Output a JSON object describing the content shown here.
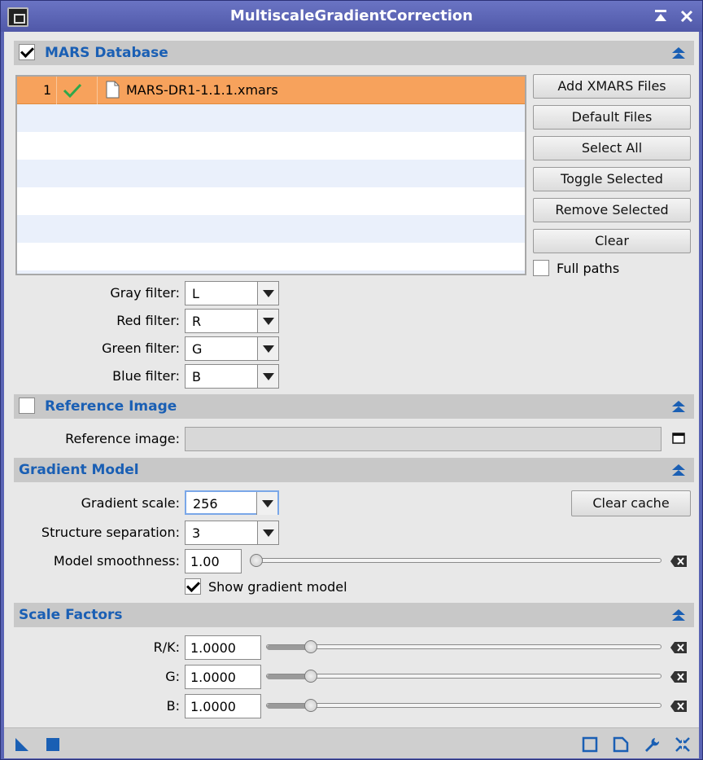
{
  "window": {
    "title": "MultiscaleGradientCorrection"
  },
  "mars": {
    "header": "MARS Database",
    "enabled": true,
    "files": [
      {
        "index": "1",
        "enabled": true,
        "name": "MARS-DR1-1.1.1.xmars"
      }
    ],
    "buttons": {
      "add": "Add XMARS Files",
      "default": "Default Files",
      "select_all": "Select All",
      "toggle": "Toggle Selected",
      "remove": "Remove Selected",
      "clear": "Clear"
    },
    "full_paths_label": "Full paths",
    "full_paths_checked": false,
    "filters": {
      "gray_label": "Gray filter:",
      "gray_value": "L",
      "red_label": "Red filter:",
      "red_value": "R",
      "green_label": "Green filter:",
      "green_value": "G",
      "blue_label": "Blue filter:",
      "blue_value": "B"
    }
  },
  "reference": {
    "header": "Reference Image",
    "enabled": false,
    "image_label": "Reference image:",
    "image_value": ""
  },
  "gradient": {
    "header": "Gradient Model",
    "scale_label": "Gradient scale:",
    "scale_value": "256",
    "clear_cache": "Clear cache",
    "separation_label": "Structure separation:",
    "separation_value": "3",
    "smoothness_label": "Model smoothness:",
    "smoothness_value": "1.00",
    "smoothness_fraction": 0.0,
    "show_model_label": "Show gradient model",
    "show_model_checked": true
  },
  "scale_factors": {
    "header": "Scale Factors",
    "rows": [
      {
        "label": "R/K:",
        "value": "1.0000",
        "fraction": 0.1
      },
      {
        "label": "G:",
        "value": "1.0000",
        "fraction": 0.1
      },
      {
        "label": "B:",
        "value": "1.0000",
        "fraction": 0.1
      }
    ]
  },
  "colors": {
    "section_title": "#1a5fb4",
    "selection": "#f7a25c",
    "window_frame": "#5a64b4"
  }
}
